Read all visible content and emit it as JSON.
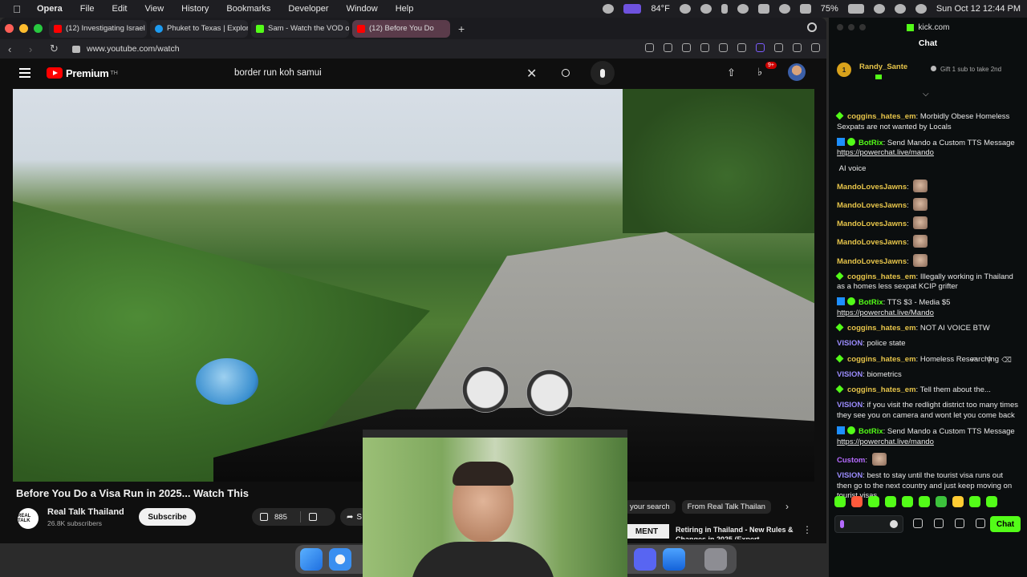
{
  "menubar": {
    "app": "Opera",
    "items": [
      "File",
      "Edit",
      "View",
      "History",
      "Bookmarks",
      "Developer",
      "Window",
      "Help"
    ],
    "weather": "84°F",
    "battery": "75%",
    "datetime": "Sun Oct 12  12:44 PM"
  },
  "browser": {
    "tabs": [
      {
        "label": "(12) Investigating Israel",
        "favicon_color": "#ff0000"
      },
      {
        "label": "Phuket to Texas | Explor",
        "favicon_color": "#1d9bf0"
      },
      {
        "label": "Sam - Watch the VOD o",
        "favicon_color": "#53fc18"
      },
      {
        "label": "(12) Before You Do",
        "favicon_color": "#ff0000"
      }
    ],
    "url": "www.youtube.com/watch"
  },
  "youtube": {
    "brand": "Premium",
    "brand_sup": "TH",
    "search_value": "border run koh samui",
    "notifications_badge": "9+",
    "video_title": "Before You Do a Visa Run in 2025... Watch This",
    "channel_name": "Real Talk Thailand",
    "channel_avatar_text": "REAL TALK",
    "subscribers": "26.8K subscribers",
    "subscribe_label": "Subscribe",
    "likes": "885",
    "share_label": "S",
    "chips": [
      "your search",
      "From Real Talk Thailan"
    ],
    "rec_thumb_text": "MENT",
    "rec_title": "Retiring in Thailand - New Rules & Changes in 2025 (Expert"
  },
  "chat": {
    "site": "kick.com",
    "heading": "Chat",
    "pinned_rank": "1",
    "pinned_user": "Randy_Sante",
    "pinned_text": "Gift 1 sub to take 2nd",
    "messages": [
      {
        "user": "",
        "text": "",
        "color": "#53fc18"
      },
      {
        "user": "coggins_hates_em",
        "text": "Morbidly Obese Homeless Sexpats are not wanted by Locals",
        "color": "#e6c44a",
        "badge": "green"
      },
      {
        "user": "BotRix",
        "text": "Send Mando a Custom TTS Message",
        "link": "https://powerchat.live/mando",
        "color": "#53fc18",
        "badge": "bot"
      },
      {
        "user": "",
        "text": "AI voice",
        "color": "#ff3355",
        "badge": "none"
      },
      {
        "user": "MandoLovesJawns",
        "text": "",
        "color": "#e6c44a",
        "badge": "none",
        "emote": true
      },
      {
        "user": "MandoLovesJawns",
        "text": "",
        "color": "#e6c44a",
        "badge": "none",
        "emote": true
      },
      {
        "user": "MandoLovesJawns",
        "text": "",
        "color": "#e6c44a",
        "badge": "none",
        "emote": true
      },
      {
        "user": "MandoLovesJawns",
        "text": "",
        "color": "#e6c44a",
        "badge": "none",
        "emote": true
      },
      {
        "user": "MandoLovesJawns",
        "text": "",
        "color": "#e6c44a",
        "badge": "none",
        "emote": true
      },
      {
        "user": "coggins_hates_em",
        "text": "Illegally working in Thailand as a homes less sexpat KCIP grifter",
        "color": "#e6c44a",
        "badge": "green"
      },
      {
        "user": "BotRix",
        "text": "TTS $3 - Media $5",
        "link": "https://powerchat.live/Mando",
        "color": "#53fc18",
        "badge": "bot"
      },
      {
        "user": "coggins_hates_em",
        "text": "NOT AI VOICE BTW",
        "color": "#e6c44a",
        "badge": "green"
      },
      {
        "user": "VISION",
        "text": "police state",
        "color": "#9b8cff",
        "badge": "none"
      },
      {
        "user": "coggins_hates_em",
        "text": "Homeless Researching",
        "color": "#e6c44a",
        "badge": "green"
      },
      {
        "user": "VISION",
        "text": "biometrics",
        "color": "#9b8cff",
        "badge": "none"
      },
      {
        "user": "coggins_hates_em",
        "text": "Tell them about the...",
        "color": "#e6c44a",
        "badge": "green"
      },
      {
        "user": "VISION",
        "text": "if you visit the redlight district too many times they see you on camera and wont let you come back",
        "color": "#9b8cff",
        "badge": "none"
      },
      {
        "user": "BotRix",
        "text": "Send Mando a Custom TTS Message",
        "link": "https://powerchat.live/mando",
        "color": "#53fc18",
        "badge": "bot"
      },
      {
        "user": "Custom",
        "text": "",
        "color": "#b56bff",
        "badge": "none",
        "emote": true
      },
      {
        "user": "VISION",
        "text": "best to stay until the tourist visa runs out then go to the next country and just keep moving on tourist visas",
        "color": "#9b8cff",
        "badge": "none"
      }
    ],
    "send_label": "Chat",
    "emote_colors": [
      "#53fc18",
      "#ff5a3c",
      "#53fc18",
      "#53fc18",
      "#53fc18",
      "#53fc18",
      "#3cc23c",
      "#ffcc33",
      "#53fc18",
      "#53fc18"
    ]
  },
  "dock": {
    "apps": [
      "finder-icon",
      "safari-icon",
      "discord-icon",
      "mail-icon",
      "trash-icon"
    ]
  }
}
